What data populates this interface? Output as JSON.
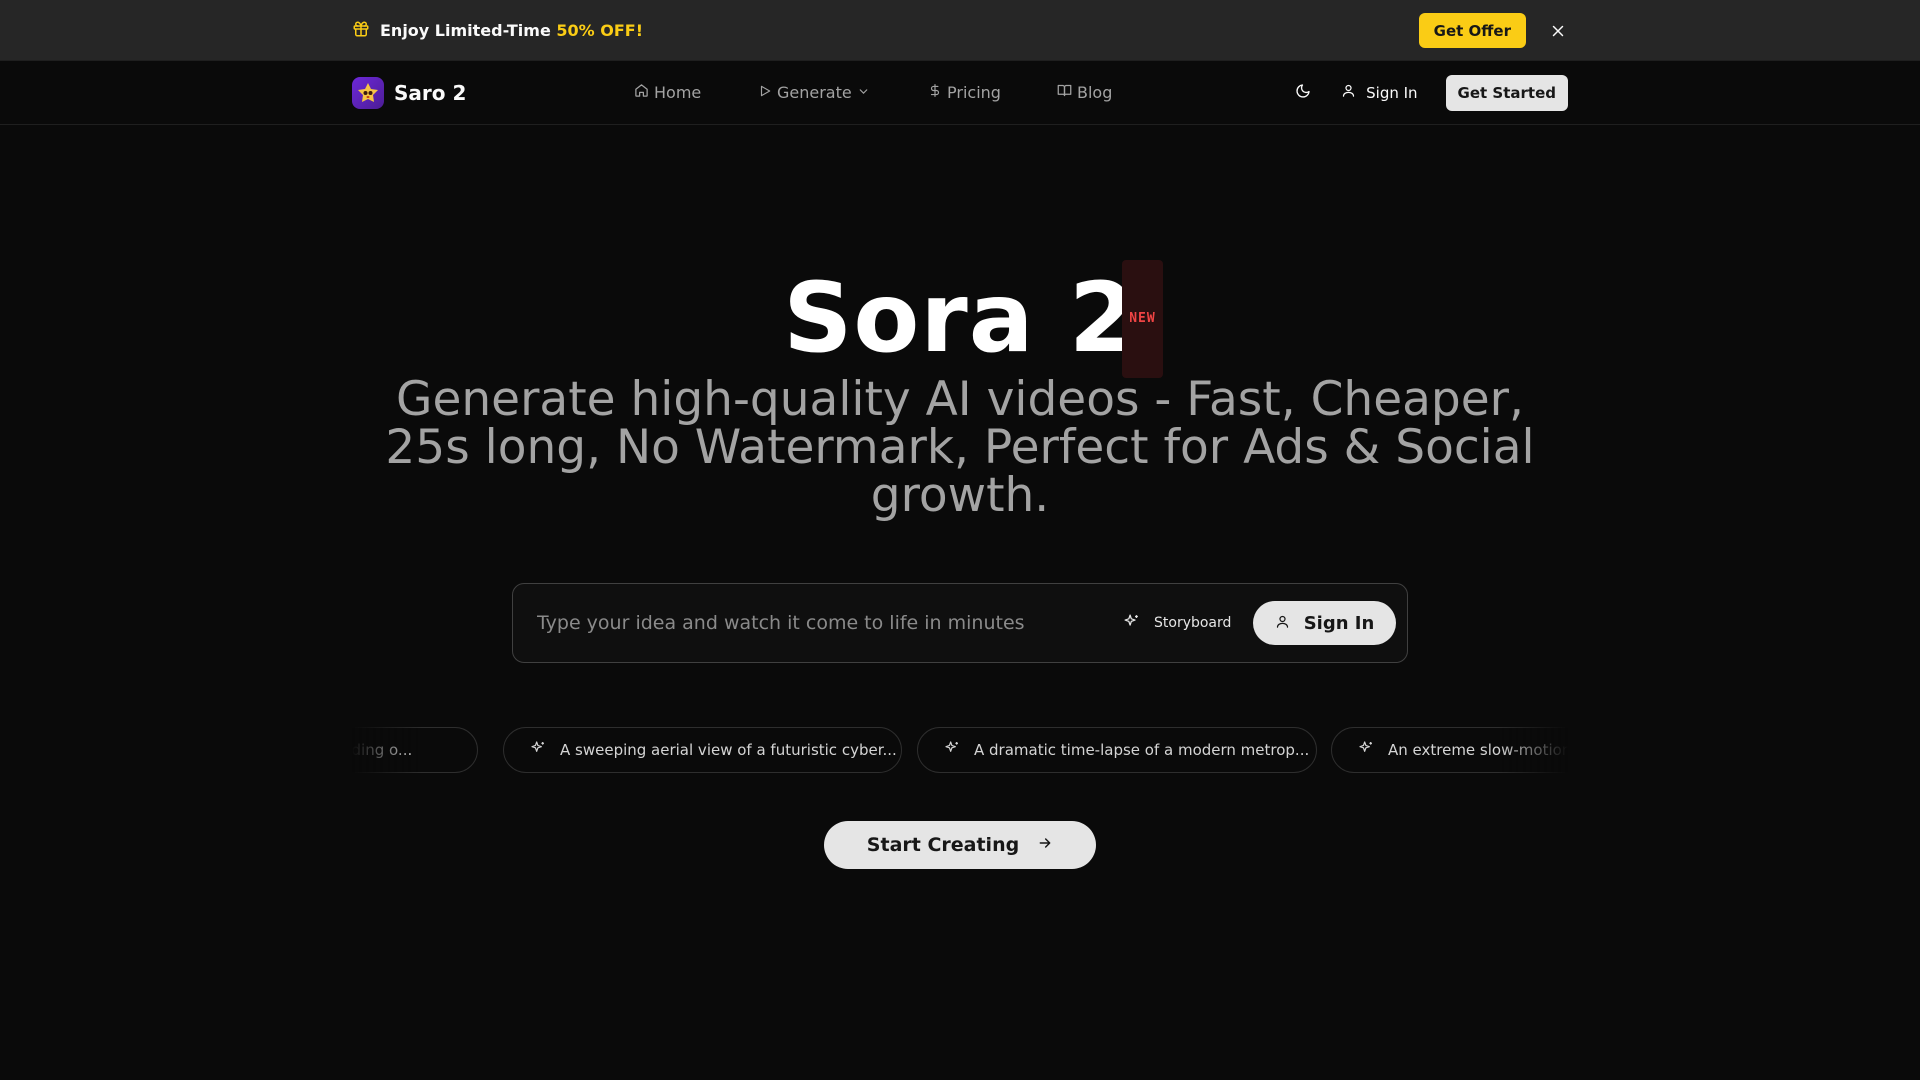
{
  "banner": {
    "text_prefix": "Enjoy Limited-Time",
    "text_accent": "50% OFF!",
    "offer_button": "Get Offer",
    "icon": "gift-icon",
    "close_icon": "close-icon",
    "accent_color": "#facc15"
  },
  "nav": {
    "brand": "Saro 2",
    "links": [
      {
        "label": "Home",
        "icon": "home-icon"
      },
      {
        "label": "Generate",
        "icon": "play-icon",
        "dropdown_icon": "chevron-down-icon"
      },
      {
        "label": "Pricing",
        "icon": "dollar-icon"
      },
      {
        "label": "Blog",
        "icon": "book-icon"
      }
    ],
    "theme_icon": "moon-icon",
    "sign_in": "Sign In",
    "get_started": "Get Started"
  },
  "hero": {
    "title": "Sora 2",
    "badge": "NEW",
    "subtitle": "Generate high-quality AI videos - Fast, Cheaper, 25s long, No Watermark, Perfect for Ads & Social growth."
  },
  "prompt": {
    "placeholder": "Type your idea and watch it come to life in minutes",
    "storyboard_label": "Storyboard",
    "sign_in_label": "Sign In"
  },
  "suggestions": [
    "...re standing o...",
    "A sweeping aerial view of a futuristic cyber...",
    "A dramatic time-lapse of a modern metrop...",
    "An extreme slow-motion c..."
  ],
  "cta": {
    "label": "Start Creating",
    "icon": "arrow-right-icon"
  }
}
